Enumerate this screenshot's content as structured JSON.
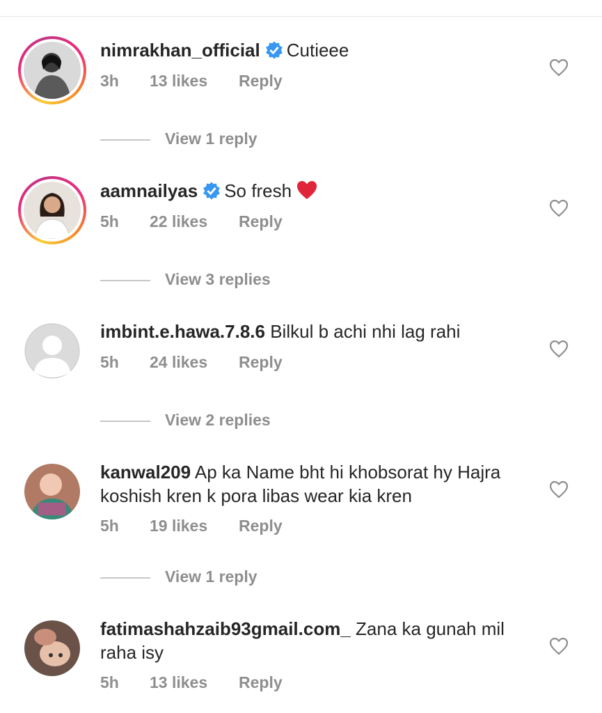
{
  "comments": [
    {
      "username": "nimrakhan_official",
      "verified": true,
      "text": "Cutieee",
      "time": "3h",
      "likes": "13 likes",
      "reply_label": "Reply",
      "avatar_icon": "profile-photo-icon",
      "story_ring": true,
      "view_replies": "View 1 reply"
    },
    {
      "username": "aamnailyas",
      "verified": true,
      "text": "So fresh",
      "emoji": "red-heart-emoji",
      "time": "5h",
      "likes": "22 likes",
      "reply_label": "Reply",
      "avatar_icon": "profile-photo-icon",
      "story_ring": true,
      "view_replies": "View 3 replies"
    },
    {
      "username": "imbint.e.hawa.7.8.6",
      "verified": false,
      "text": "Bilkul b achi nhi lag rahi",
      "time": "5h",
      "likes": "24 likes",
      "reply_label": "Reply",
      "avatar_icon": "default-avatar-icon",
      "story_ring": false,
      "view_replies": "View 2 replies"
    },
    {
      "username": "kanwal209",
      "verified": false,
      "text": "Ap ka Name bht hi khobsorat hy Hajra koshish kren k pora libas wear kia kren",
      "time": "5h",
      "likes": "19 likes",
      "reply_label": "Reply",
      "avatar_icon": "profile-photo-icon",
      "story_ring": false,
      "view_replies": "View 1 reply"
    },
    {
      "username": "fatimashahzaib93gmail.com_",
      "verified": false,
      "text": "Zana ka gunah mil raha isy",
      "time": "5h",
      "likes": "13 likes",
      "reply_label": "Reply",
      "avatar_icon": "profile-photo-icon",
      "story_ring": false
    }
  ],
  "colors": {
    "text": "#262626",
    "muted": "#8e8e8e",
    "verified": "#3897f0",
    "heart_emoji": "#e0243a"
  }
}
